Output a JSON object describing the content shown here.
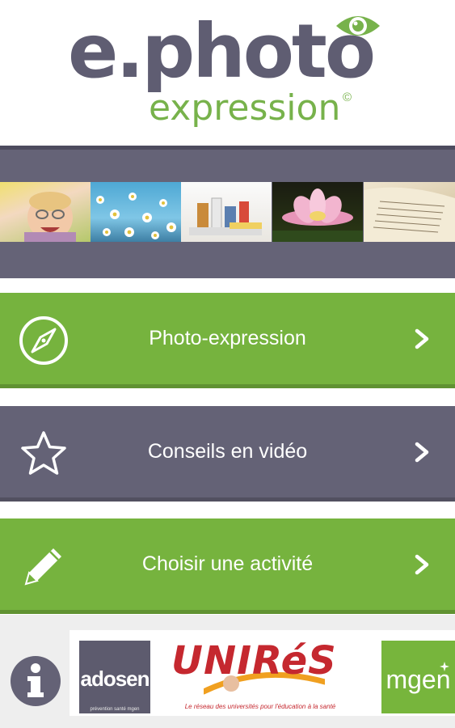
{
  "header": {
    "logo_main": "e.photo",
    "logo_sub": "expression",
    "copyright": "©",
    "eye_icon": "eye-icon"
  },
  "photo_strip": {
    "photos": [
      "child-photo",
      "daisies-photo",
      "medicines-photo",
      "waterlily-photo",
      "book-photo"
    ]
  },
  "menu": {
    "items": [
      {
        "label": "Photo-expression",
        "icon": "compass-icon",
        "color": "#76b33e"
      },
      {
        "label": "Conseils en vidéo",
        "icon": "star-icon",
        "color": "#646276"
      },
      {
        "label": "Choisir une activité",
        "icon": "pencil-icon",
        "color": "#76b33e"
      }
    ]
  },
  "footer": {
    "info_icon": "info-icon",
    "partners": {
      "adosen": {
        "name": "adosen",
        "tagline": "prévention santé mgen"
      },
      "unires": {
        "name": "UNIRéS",
        "tagline": "Le réseau des universités pour l'éducation à la santé"
      },
      "mgen": {
        "name": "mgen"
      }
    }
  },
  "colors": {
    "brand_green": "#76b33e",
    "brand_gray": "#646276",
    "logo_gray": "#5f5d72",
    "unires_red": "#c5282f"
  }
}
